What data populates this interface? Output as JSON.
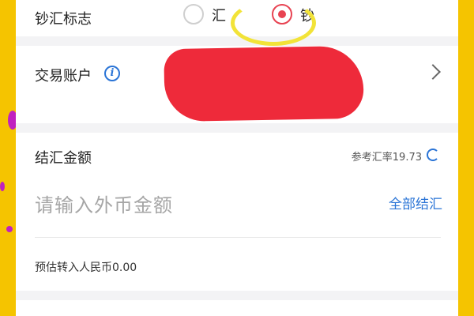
{
  "exchange_mark": {
    "label": "钞汇标志",
    "options": [
      {
        "label": "汇",
        "selected": false
      },
      {
        "label": "钞",
        "selected": true
      }
    ]
  },
  "trade_account": {
    "label": "交易账户",
    "info_icon": "i"
  },
  "settlement": {
    "label": "结汇金额",
    "reference_rate": "参考汇率19.73",
    "amount_placeholder": "请输入外币金额",
    "settle_all": "全部结汇",
    "estimated_rmb": "预估转入人民币0.00"
  },
  "colors": {
    "accent_blue": "#2a74d6",
    "selected_red": "#e84352",
    "redaction_red": "#ee2a3a",
    "frame_yellow": "#f5c400",
    "annotation_yellow": "#f2e338"
  },
  "icons": [
    "info-icon",
    "chevron-right-icon",
    "refresh-icon"
  ]
}
